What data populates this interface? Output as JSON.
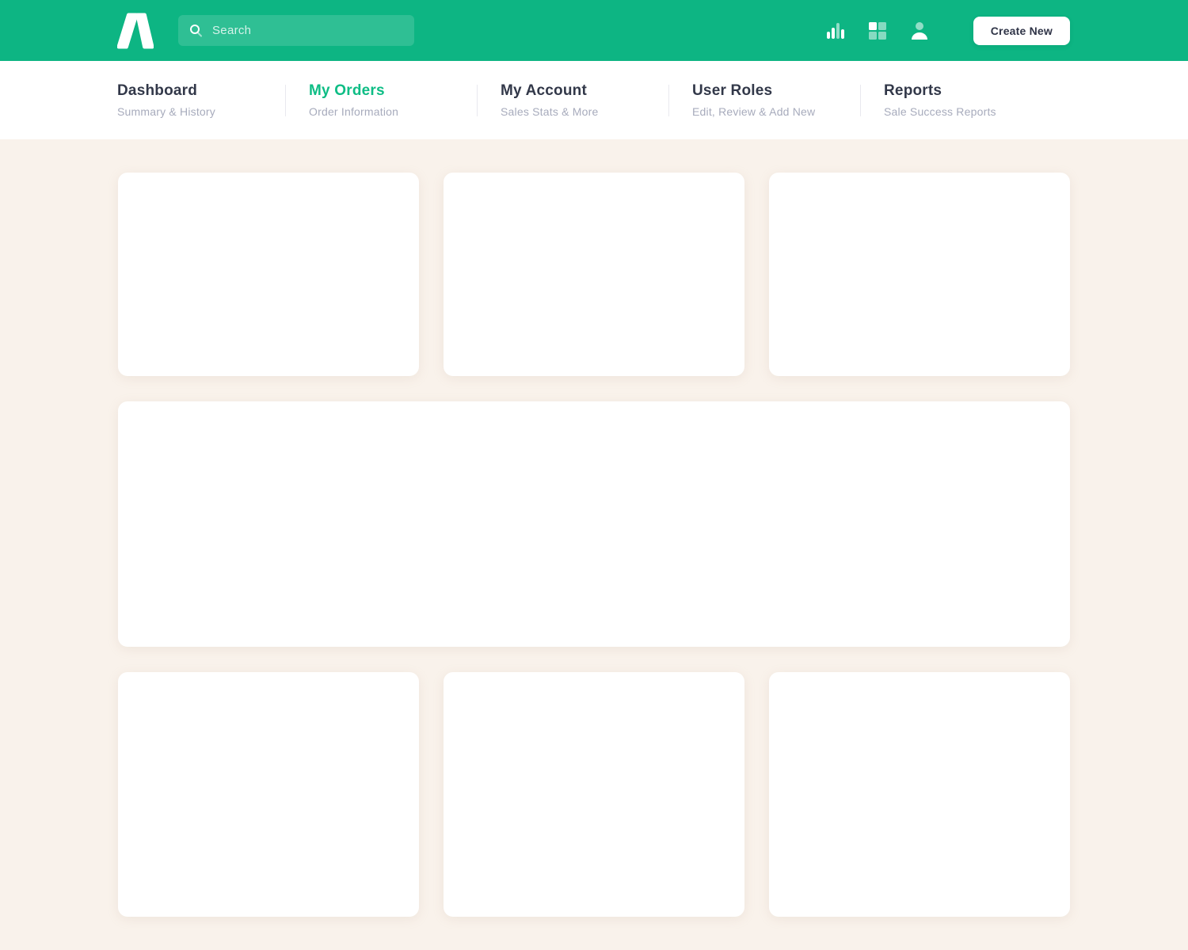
{
  "colors": {
    "brand_green": "#0DB583",
    "active_nav_green": "#0EBD85",
    "page_background": "#F9F2EB",
    "nav_title_text": "#323849",
    "nav_subtitle_text": "#A7ABBC"
  },
  "header": {
    "logo_icon": "brand-logo-a-mark",
    "search": {
      "placeholder": "Search",
      "value": ""
    },
    "icons": [
      {
        "name": "bar-chart-icon"
      },
      {
        "name": "grid-icon"
      },
      {
        "name": "profile-icon"
      }
    ],
    "create_button_label": "Create New"
  },
  "nav": {
    "items": [
      {
        "label": "Dashboard",
        "sublabel": "Summary & History",
        "active": false
      },
      {
        "label": "My Orders",
        "sublabel": "Order Information",
        "active": true
      },
      {
        "label": "My Account",
        "sublabel": "Sales Stats & More",
        "active": false
      },
      {
        "label": "User Roles",
        "sublabel": "Edit, Review & Add New",
        "active": false
      },
      {
        "label": "Reports",
        "sublabel": "Sale Success Reports",
        "active": false
      }
    ]
  },
  "main": {
    "cards": [
      {
        "name": "card-top-1",
        "content": ""
      },
      {
        "name": "card-top-2",
        "content": ""
      },
      {
        "name": "card-top-3",
        "content": ""
      },
      {
        "name": "card-wide",
        "content": ""
      },
      {
        "name": "card-bottom-1",
        "content": ""
      },
      {
        "name": "card-bottom-2",
        "content": ""
      },
      {
        "name": "card-bottom-3",
        "content": ""
      }
    ]
  }
}
